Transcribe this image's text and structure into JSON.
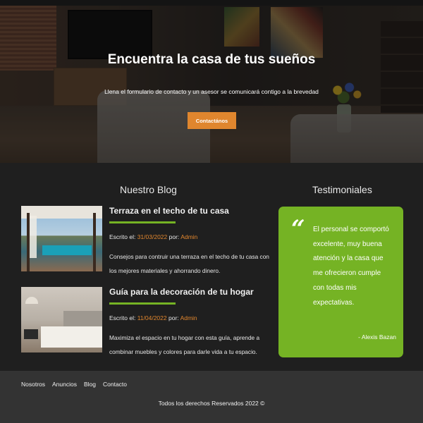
{
  "hero": {
    "title": "Encuentra la casa de tus sueños",
    "subtitle": "Llena el formulario de contacto y un asesor se comunicará contigo a la brevedad",
    "cta_label": "Contactános"
  },
  "blog": {
    "heading": "Nuestro Blog",
    "posts": [
      {
        "title": "Terraza en el techo de tu casa",
        "written_label": "Escrito el:",
        "date": "31/03/2022",
        "by_label": "por:",
        "author": "Admin",
        "description": "Consejos para contruir una terraza en el techo de tu casa con los mejores materiales y ahorrando dinero."
      },
      {
        "title": "Guía para la decoración de tu hogar",
        "written_label": "Escrito el:",
        "date": "11/04/2022",
        "by_label": "por:",
        "author": "Admin",
        "description": "Maximiza el espacio en tu hogar con esta guía, aprende a combinar muebles y colores para darle vida a tu espacio."
      }
    ]
  },
  "testimonials": {
    "heading": "Testimoniales",
    "quote_mark": "“",
    "text": "El personal se comportó excelente, muy buena atención y la casa que me ofrecieron cumple con todas mis expectativas.",
    "author": "- Alexis Bazan"
  },
  "footer": {
    "nav": [
      "Nosotros",
      "Anuncios",
      "Blog",
      "Contacto"
    ],
    "copyright": "Todos los derechos Reservados 2022 ©"
  },
  "colors": {
    "accent_orange": "#e0862e",
    "accent_green": "#75b324",
    "background": "#1f1f1f",
    "footer_bg": "#333333"
  }
}
